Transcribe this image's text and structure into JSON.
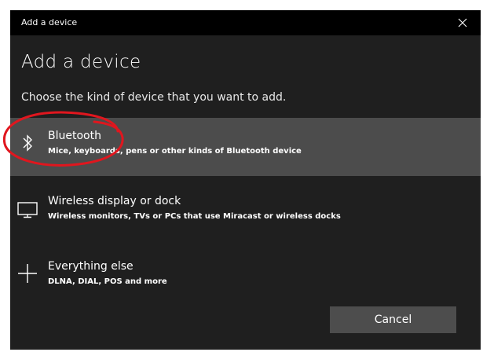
{
  "window": {
    "title": "Add a device",
    "close_icon": "close-icon"
  },
  "heading": "Add a device",
  "subheading": "Choose the kind of device that you want to add.",
  "options": [
    {
      "icon": "bluetooth-icon",
      "label": "Bluetooth",
      "description": "Mice, keyboards, pens or other kinds of Bluetooth device",
      "selected": true
    },
    {
      "icon": "monitor-icon",
      "label": "Wireless display or dock",
      "description": "Wireless monitors, TVs or PCs that use Miracast or wireless docks",
      "selected": false
    },
    {
      "icon": "plus-icon",
      "label": "Everything else",
      "description": "DLNA, DIAL, POS and more",
      "selected": false
    }
  ],
  "buttons": {
    "cancel_label": "Cancel"
  },
  "colors": {
    "dialog_bg": "#1f1f1f",
    "titlebar_bg": "#000000",
    "selected_bg": "#4c4c4c",
    "button_bg": "#4d4d4d",
    "annotation": "#e0161e"
  }
}
